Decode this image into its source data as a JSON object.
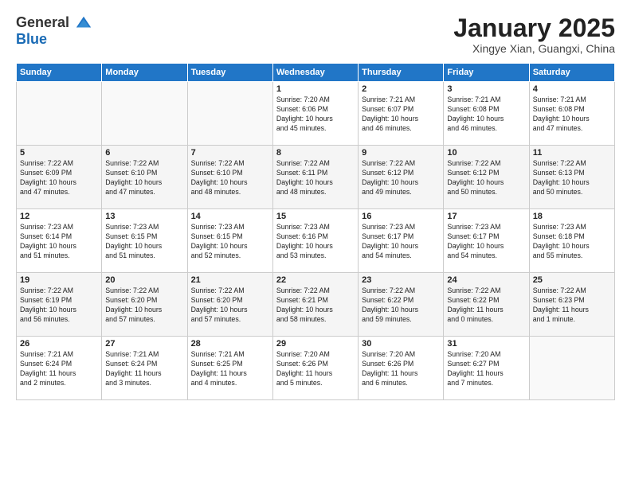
{
  "header": {
    "logo_line1": "General",
    "logo_line2": "Blue",
    "title": "January 2025",
    "subtitle": "Xingye Xian, Guangxi, China"
  },
  "days_of_week": [
    "Sunday",
    "Monday",
    "Tuesday",
    "Wednesday",
    "Thursday",
    "Friday",
    "Saturday"
  ],
  "weeks": [
    [
      {
        "day": "",
        "info": ""
      },
      {
        "day": "",
        "info": ""
      },
      {
        "day": "",
        "info": ""
      },
      {
        "day": "1",
        "info": "Sunrise: 7:20 AM\nSunset: 6:06 PM\nDaylight: 10 hours\nand 45 minutes."
      },
      {
        "day": "2",
        "info": "Sunrise: 7:21 AM\nSunset: 6:07 PM\nDaylight: 10 hours\nand 46 minutes."
      },
      {
        "day": "3",
        "info": "Sunrise: 7:21 AM\nSunset: 6:08 PM\nDaylight: 10 hours\nand 46 minutes."
      },
      {
        "day": "4",
        "info": "Sunrise: 7:21 AM\nSunset: 6:08 PM\nDaylight: 10 hours\nand 47 minutes."
      }
    ],
    [
      {
        "day": "5",
        "info": "Sunrise: 7:22 AM\nSunset: 6:09 PM\nDaylight: 10 hours\nand 47 minutes."
      },
      {
        "day": "6",
        "info": "Sunrise: 7:22 AM\nSunset: 6:10 PM\nDaylight: 10 hours\nand 47 minutes."
      },
      {
        "day": "7",
        "info": "Sunrise: 7:22 AM\nSunset: 6:10 PM\nDaylight: 10 hours\nand 48 minutes."
      },
      {
        "day": "8",
        "info": "Sunrise: 7:22 AM\nSunset: 6:11 PM\nDaylight: 10 hours\nand 48 minutes."
      },
      {
        "day": "9",
        "info": "Sunrise: 7:22 AM\nSunset: 6:12 PM\nDaylight: 10 hours\nand 49 minutes."
      },
      {
        "day": "10",
        "info": "Sunrise: 7:22 AM\nSunset: 6:12 PM\nDaylight: 10 hours\nand 50 minutes."
      },
      {
        "day": "11",
        "info": "Sunrise: 7:22 AM\nSunset: 6:13 PM\nDaylight: 10 hours\nand 50 minutes."
      }
    ],
    [
      {
        "day": "12",
        "info": "Sunrise: 7:23 AM\nSunset: 6:14 PM\nDaylight: 10 hours\nand 51 minutes."
      },
      {
        "day": "13",
        "info": "Sunrise: 7:23 AM\nSunset: 6:15 PM\nDaylight: 10 hours\nand 51 minutes."
      },
      {
        "day": "14",
        "info": "Sunrise: 7:23 AM\nSunset: 6:15 PM\nDaylight: 10 hours\nand 52 minutes."
      },
      {
        "day": "15",
        "info": "Sunrise: 7:23 AM\nSunset: 6:16 PM\nDaylight: 10 hours\nand 53 minutes."
      },
      {
        "day": "16",
        "info": "Sunrise: 7:23 AM\nSunset: 6:17 PM\nDaylight: 10 hours\nand 54 minutes."
      },
      {
        "day": "17",
        "info": "Sunrise: 7:23 AM\nSunset: 6:17 PM\nDaylight: 10 hours\nand 54 minutes."
      },
      {
        "day": "18",
        "info": "Sunrise: 7:23 AM\nSunset: 6:18 PM\nDaylight: 10 hours\nand 55 minutes."
      }
    ],
    [
      {
        "day": "19",
        "info": "Sunrise: 7:22 AM\nSunset: 6:19 PM\nDaylight: 10 hours\nand 56 minutes."
      },
      {
        "day": "20",
        "info": "Sunrise: 7:22 AM\nSunset: 6:20 PM\nDaylight: 10 hours\nand 57 minutes."
      },
      {
        "day": "21",
        "info": "Sunrise: 7:22 AM\nSunset: 6:20 PM\nDaylight: 10 hours\nand 57 minutes."
      },
      {
        "day": "22",
        "info": "Sunrise: 7:22 AM\nSunset: 6:21 PM\nDaylight: 10 hours\nand 58 minutes."
      },
      {
        "day": "23",
        "info": "Sunrise: 7:22 AM\nSunset: 6:22 PM\nDaylight: 10 hours\nand 59 minutes."
      },
      {
        "day": "24",
        "info": "Sunrise: 7:22 AM\nSunset: 6:22 PM\nDaylight: 11 hours\nand 0 minutes."
      },
      {
        "day": "25",
        "info": "Sunrise: 7:22 AM\nSunset: 6:23 PM\nDaylight: 11 hours\nand 1 minute."
      }
    ],
    [
      {
        "day": "26",
        "info": "Sunrise: 7:21 AM\nSunset: 6:24 PM\nDaylight: 11 hours\nand 2 minutes."
      },
      {
        "day": "27",
        "info": "Sunrise: 7:21 AM\nSunset: 6:24 PM\nDaylight: 11 hours\nand 3 minutes."
      },
      {
        "day": "28",
        "info": "Sunrise: 7:21 AM\nSunset: 6:25 PM\nDaylight: 11 hours\nand 4 minutes."
      },
      {
        "day": "29",
        "info": "Sunrise: 7:20 AM\nSunset: 6:26 PM\nDaylight: 11 hours\nand 5 minutes."
      },
      {
        "day": "30",
        "info": "Sunrise: 7:20 AM\nSunset: 6:26 PM\nDaylight: 11 hours\nand 6 minutes."
      },
      {
        "day": "31",
        "info": "Sunrise: 7:20 AM\nSunset: 6:27 PM\nDaylight: 11 hours\nand 7 minutes."
      },
      {
        "day": "",
        "info": ""
      }
    ]
  ]
}
